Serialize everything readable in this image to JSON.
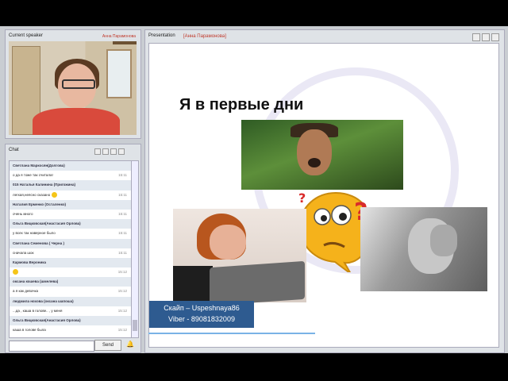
{
  "speaker_panel": {
    "title": "Current speaker",
    "speaker_name": "Анна Парамонова"
  },
  "presentation_panel": {
    "title": "Presentation",
    "presenter": "[Анна Парамонова]",
    "slide": {
      "title": "Я в первые дни",
      "contact_lines": [
        "Скайп – Uspeshnaya86",
        "Viber - 89081832009"
      ]
    }
  },
  "chat": {
    "title": "Chat",
    "messages": [
      {
        "text": "Светлана Маркосян(Долгова)",
        "time": "",
        "author": true
      },
      {
        "text": "о да я тоже так считала!",
        "time": "15:11",
        "author": false
      },
      {
        "text": "015 Наталья Калинина (Пригожина)",
        "time": "",
        "author": true
      },
      {
        "text": "легкая,неясно сказано",
        "time": "15:11",
        "author": false
      },
      {
        "text": "Наталия Ерменко (Осталенко)",
        "time": "",
        "author": true
      },
      {
        "text": "очень много",
        "time": "15:11",
        "author": false
      },
      {
        "text": "Ольга Вицковская(Анастасия Орлова)",
        "time": "",
        "author": true
      },
      {
        "text": "у всех так наверное было",
        "time": "15:11",
        "author": false
      },
      {
        "text": "Светлана Семенова ( Черна )",
        "time": "",
        "author": true
      },
      {
        "text": "сначала шок",
        "time": "15:11",
        "author": false
      },
      {
        "text": "Кармова Вероника",
        "time": "",
        "author": true
      },
      {
        "text": "",
        "time": "15:12",
        "author": false
      },
      {
        "text": "оксана кошева (шмелева)",
        "time": "",
        "author": true
      },
      {
        "text": "а я как девочка",
        "time": "15:12",
        "author": false
      },
      {
        "text": "людмила нохова (оксана шапоша)",
        "time": "",
        "author": true
      },
      {
        "text": "...да , каша в голове.. , у меня",
        "time": "15:12",
        "author": false
      },
      {
        "text": "Ольга Вицковская(Анастасия Орлова)",
        "time": "",
        "author": true
      },
      {
        "text": "каша в голове была",
        "time": "15:12",
        "author": false
      }
    ],
    "send_label": "Send",
    "input_value": ""
  },
  "colors": {
    "app_bg": "#c9cdd2",
    "contact_box": "#2e5b90",
    "speaker_name": "#c0392b",
    "progress": "#7ab3e6"
  }
}
